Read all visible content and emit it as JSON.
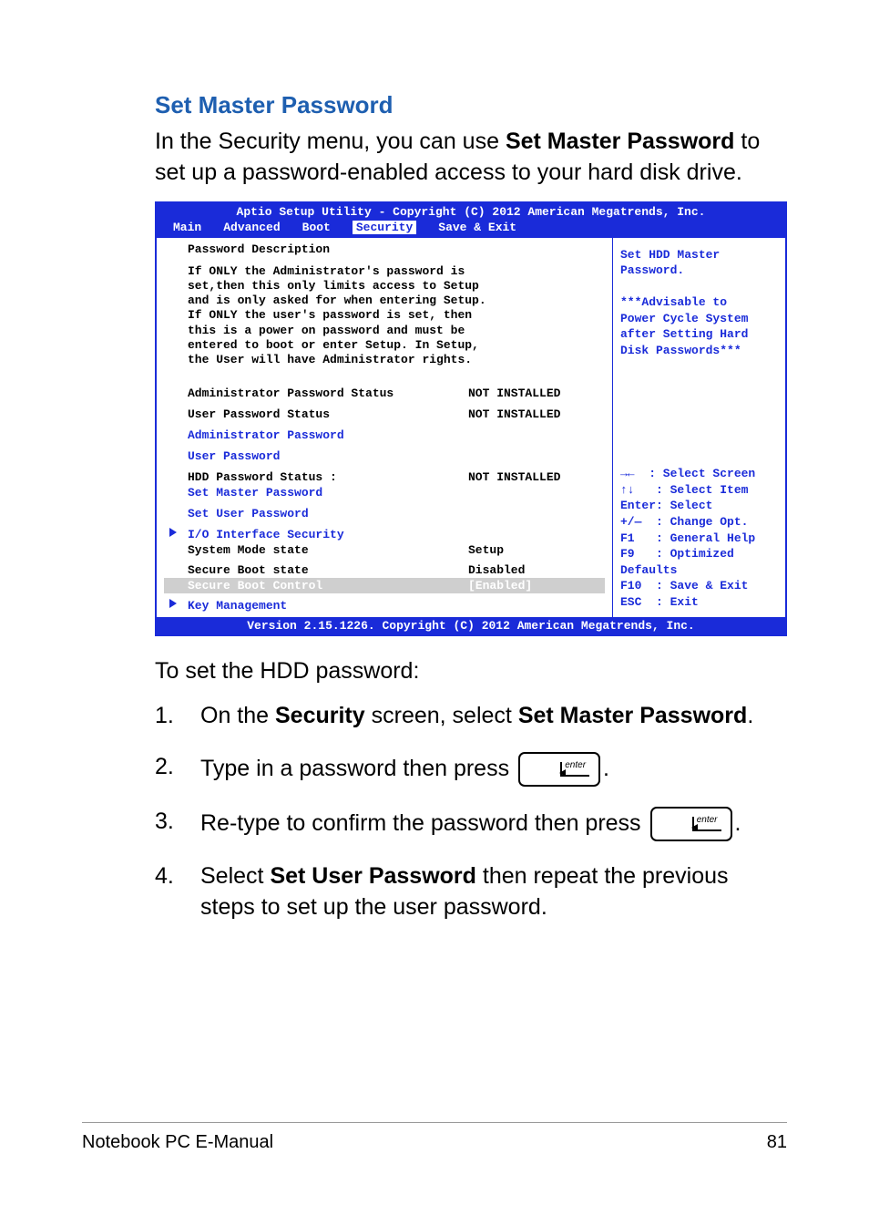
{
  "heading": "Set Master Password",
  "intro_pre": "In the Security menu, you can use ",
  "intro_bold": "Set Master Password",
  "intro_post": " to set up a password-enabled access to your hard disk drive.",
  "bios": {
    "title": "Aptio Setup Utility - Copyright (C) 2012 American Megatrends, Inc.",
    "tabs": [
      "Main",
      "Advanced",
      "Boot",
      "Security",
      "Save & Exit"
    ],
    "active_tab": "Security",
    "desc_heading": "Password Description",
    "desc_lines": [
      "If ONLY the Administrator's password is",
      "set,then this only limits access to Setup",
      "and is only asked for when entering Setup.",
      "If ONLY the user's password is set, then",
      "this is a power on password and must be",
      "entered to boot or enter Setup. In Setup,",
      "the User will have Administrator rights."
    ],
    "rows": {
      "admin_status_label": "Administrator Password Status",
      "admin_status_value": "NOT INSTALLED",
      "user_status_label": "User Password Status",
      "user_status_value": "NOT INSTALLED",
      "admin_pw": "Administrator Password",
      "user_pw": "User Password",
      "hdd_status_label": "HDD Password Status :",
      "hdd_status_value": "NOT INSTALLED",
      "set_master": "Set Master Password",
      "set_user": "Set User Password",
      "io_sec": "I/O Interface Security",
      "sys_mode_label": "System Mode state",
      "sys_mode_value": "Setup",
      "secure_state_label": "Secure Boot state",
      "secure_state_value": "Disabled",
      "secure_ctrl_label": "Secure Boot Control",
      "secure_ctrl_value": "[Enabled]",
      "key_mgmt": "Key Management"
    },
    "help_top": "Set HDD Master\nPassword.\n\n***Advisable to\nPower Cycle System\nafter Setting Hard\nDisk Passwords***",
    "help_bottom": "→←  : Select Screen\n↑↓   : Select Item\nEnter: Select\n+/—  : Change Opt.\nF1   : General Help\nF9   : Optimized\nDefaults\nF10  : Save & Exit\nESC  : Exit",
    "footer": "Version 2.15.1226. Copyright (C) 2012 American Megatrends, Inc."
  },
  "after_bios": "To set the HDD password:",
  "steps": {
    "s1_num": "1.",
    "s1_a": "On the ",
    "s1_b": "Security",
    "s1_c": " screen, select ",
    "s1_d": "Set Master Password",
    "s1_e": ".",
    "s2_num": "2.",
    "s2_a": "Type in a password then press ",
    "s2_b": ".",
    "s3_num": "3.",
    "s3_a": "Re-type to confirm the password then press ",
    "s3_b": ".",
    "s4_num": "4.",
    "s4_a": "Select ",
    "s4_b": "Set User Password",
    "s4_c": " then repeat the previous steps to set up the user password."
  },
  "enter_key": "enter",
  "footer": {
    "left": "Notebook PC E-Manual",
    "right": "81"
  }
}
